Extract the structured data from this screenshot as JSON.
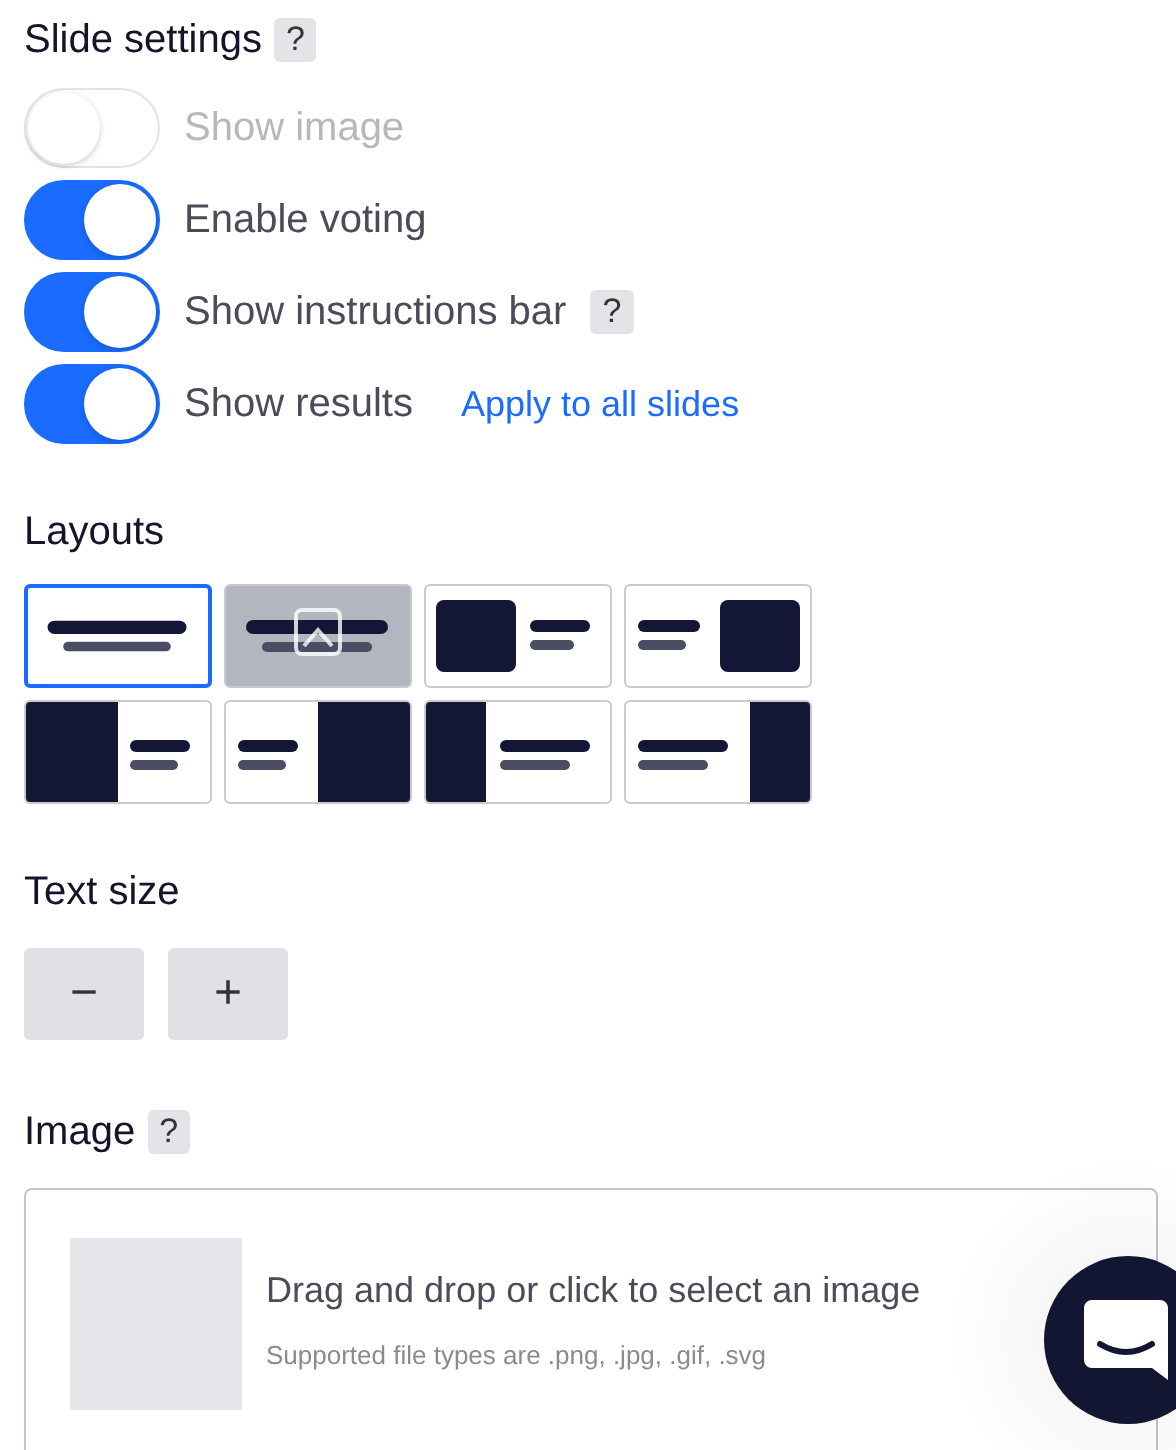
{
  "slide_settings": {
    "title": "Slide settings",
    "help": "?",
    "toggles": [
      {
        "label": "Show image",
        "on": false,
        "disabled": true
      },
      {
        "label": "Enable voting",
        "on": true,
        "disabled": false
      },
      {
        "label": "Show instructions bar",
        "on": true,
        "disabled": false,
        "help": "?"
      },
      {
        "label": "Show results",
        "on": true,
        "disabled": false,
        "link": "Apply to all slides"
      }
    ]
  },
  "layouts": {
    "title": "Layouts",
    "items": [
      {
        "kind": "centered",
        "selected": true,
        "hovered": false
      },
      {
        "kind": "centered",
        "selected": false,
        "hovered": true
      },
      {
        "kind": "card-left",
        "selected": false,
        "hovered": false
      },
      {
        "kind": "card-right",
        "selected": false,
        "hovered": false
      },
      {
        "kind": "half-left",
        "selected": false,
        "hovered": false
      },
      {
        "kind": "half-right",
        "selected": false,
        "hovered": false
      },
      {
        "kind": "strip-left",
        "selected": false,
        "hovered": false
      },
      {
        "kind": "strip-right",
        "selected": false,
        "hovered": false
      }
    ]
  },
  "text_size": {
    "title": "Text size",
    "buttons": [
      "−",
      "+"
    ]
  },
  "image": {
    "title": "Image",
    "help": "?",
    "dropzone": {
      "text": "Drag and drop or click to select an image",
      "hint": "Supported file types are .png, .jpg, .gif, .svg"
    }
  }
}
